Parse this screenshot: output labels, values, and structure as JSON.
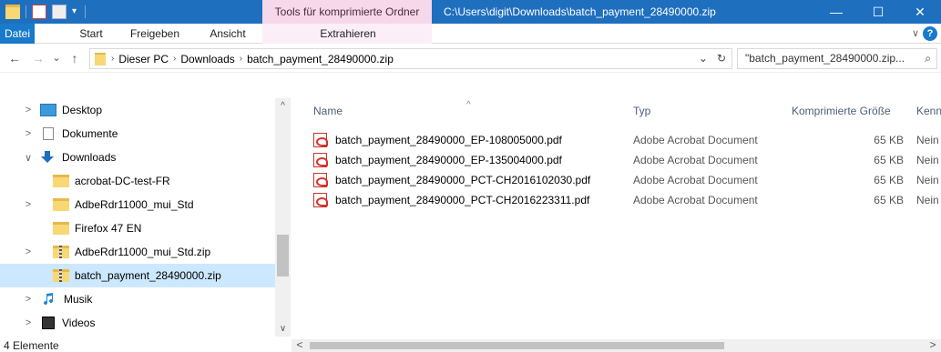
{
  "titlebar": {
    "context_tab": "Tools für komprimierte Ordner",
    "window_title": "C:\\Users\\digit\\Downloads\\batch_payment_28490000.zip",
    "minimize": "—",
    "maximize": "☐",
    "close": "✕"
  },
  "ribbon": {
    "tabs": [
      "Datei",
      "Start",
      "Freigeben",
      "Ansicht",
      "Extrahieren"
    ],
    "expand": "∨",
    "help": "?"
  },
  "nav": {
    "back": "←",
    "forward": "→",
    "history": "⌄",
    "up": "↑"
  },
  "address": {
    "crumbs": [
      "Dieser PC",
      "Downloads",
      "batch_payment_28490000.zip"
    ],
    "dropdown": "⌄",
    "refresh": "↻"
  },
  "search": {
    "value": "\"batch_payment_28490000.zip...",
    "icon": "⌕"
  },
  "tree": {
    "items": [
      {
        "label": "Desktop",
        "expander": ">",
        "icon": "desktop-icon"
      },
      {
        "label": "Dokumente",
        "expander": ">",
        "icon": "documents-icon"
      },
      {
        "label": "Downloads",
        "expander": "∨",
        "icon": "downloads-icon"
      },
      {
        "label": "acrobat-DC-test-FR",
        "expander": "",
        "icon": "folder-icon"
      },
      {
        "label": "AdbeRdr11000_mui_Std",
        "expander": ">",
        "icon": "folder-icon"
      },
      {
        "label": "Firefox 47 EN",
        "expander": "",
        "icon": "folder-icon"
      },
      {
        "label": "AdbeRdr11000_mui_Std.zip",
        "expander": ">",
        "icon": "zip-folder-icon"
      },
      {
        "label": "batch_payment_28490000.zip",
        "expander": "",
        "icon": "zip-folder-icon"
      },
      {
        "label": "Musik",
        "expander": ">",
        "icon": "music-icon"
      },
      {
        "label": "Videos",
        "expander": ">",
        "icon": "videos-icon"
      }
    ]
  },
  "list": {
    "sort_indicator": "^",
    "columns": [
      "Name",
      "Typ",
      "Komprimierte Größe",
      "Kennw"
    ],
    "rows": [
      {
        "name": "batch_payment_28490000_EP-108005000.pdf",
        "type": "Adobe Acrobat Document",
        "size": "65 KB",
        "protected": "Nein"
      },
      {
        "name": "batch_payment_28490000_EP-135004000.pdf",
        "type": "Adobe Acrobat Document",
        "size": "65 KB",
        "protected": "Nein"
      },
      {
        "name": "batch_payment_28490000_PCT-CH2016102030.pdf",
        "type": "Adobe Acrobat Document",
        "size": "65 KB",
        "protected": "Nein"
      },
      {
        "name": "batch_payment_28490000_PCT-CH2016223311.pdf",
        "type": "Adobe Acrobat Document",
        "size": "65 KB",
        "protected": "Nein"
      }
    ]
  },
  "scroll": {
    "up": "^",
    "down": "∨",
    "left": "<",
    "right": ">"
  },
  "status": {
    "count": "4 Elemente"
  },
  "colors": {
    "titlebar": "#1f6fbf",
    "context_tab": "#f6d8ea",
    "selection": "#cce8ff",
    "active_tab": "#1979ca"
  }
}
